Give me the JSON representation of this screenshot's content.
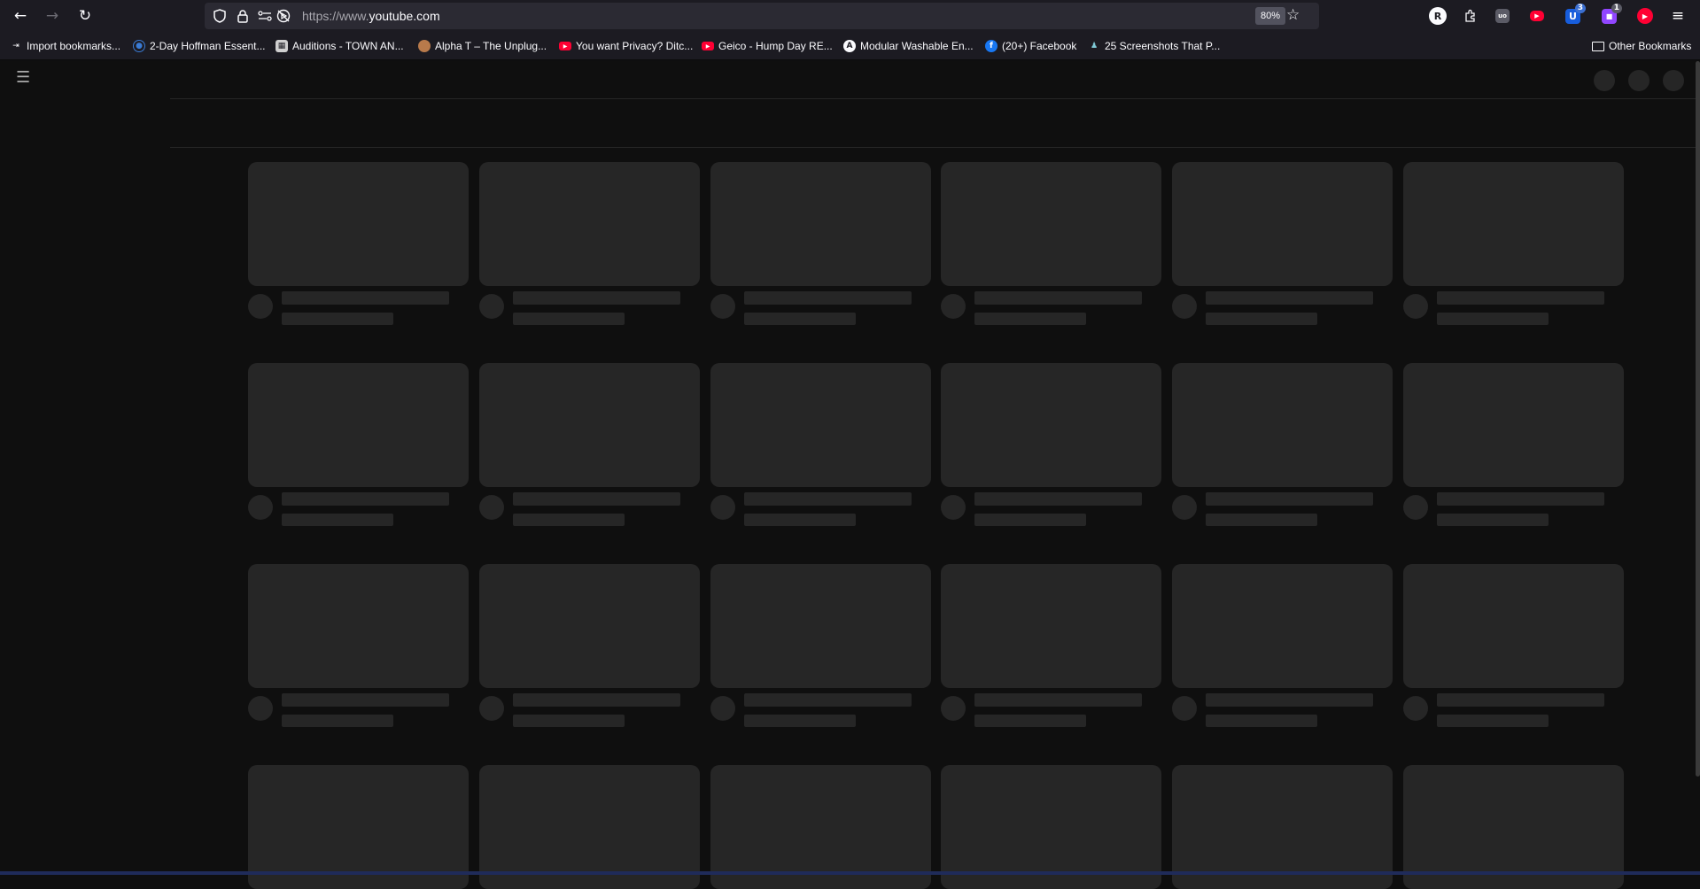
{
  "browser": {
    "url_prefix": "https://www.",
    "url_domain": "youtube.com",
    "zoom": "80%",
    "extensions": [
      {
        "name": "profile-avatar",
        "label": "R",
        "color": "#fbfbfe",
        "text_color": "#1c1b22"
      },
      {
        "name": "extensions-puzzle",
        "label": "",
        "color": "transparent"
      },
      {
        "name": "ublock-origin",
        "label": "",
        "color": "#5b5b66"
      },
      {
        "name": "youtube-ext-1",
        "label": "",
        "color": "#ff0033"
      },
      {
        "name": "bitwarden",
        "label": "",
        "color": "#175ddc",
        "count": "3"
      },
      {
        "name": "twitch-ext",
        "label": "",
        "color": "#9146ff",
        "count": "1"
      },
      {
        "name": "youtube-ext-2",
        "label": "",
        "color": "#ff0033"
      }
    ]
  },
  "bookmarks": [
    {
      "label": "Import bookmarks...",
      "icon": "import-icon",
      "color": "#fbfbfe"
    },
    {
      "label": "2-Day Hoffman Essent...",
      "icon": "globe-icon",
      "color": "#3a7bd5"
    },
    {
      "label": "Auditions - TOWN AN...",
      "icon": "clapper-icon",
      "color": "#cfcfcf"
    },
    {
      "label": "Alpha T – The Unplug...",
      "icon": "avatar-icon",
      "color": "#b87a4b"
    },
    {
      "label": "You want Privacy? Ditc...",
      "icon": "youtube-icon",
      "color": "#ff0033"
    },
    {
      "label": "Geico - Hump Day RE...",
      "icon": "youtube-icon",
      "color": "#ff0033"
    },
    {
      "label": "Modular Washable En...",
      "icon": "letter-a-icon",
      "color": "#fbfbfe"
    },
    {
      "label": "(20+) Facebook",
      "icon": "facebook-icon",
      "color": "#1877f2"
    },
    {
      "label": "25 Screenshots That P...",
      "icon": "figure-icon",
      "color": "#7fc9d6"
    }
  ],
  "other_bookmarks": "Other Bookmarks"
}
